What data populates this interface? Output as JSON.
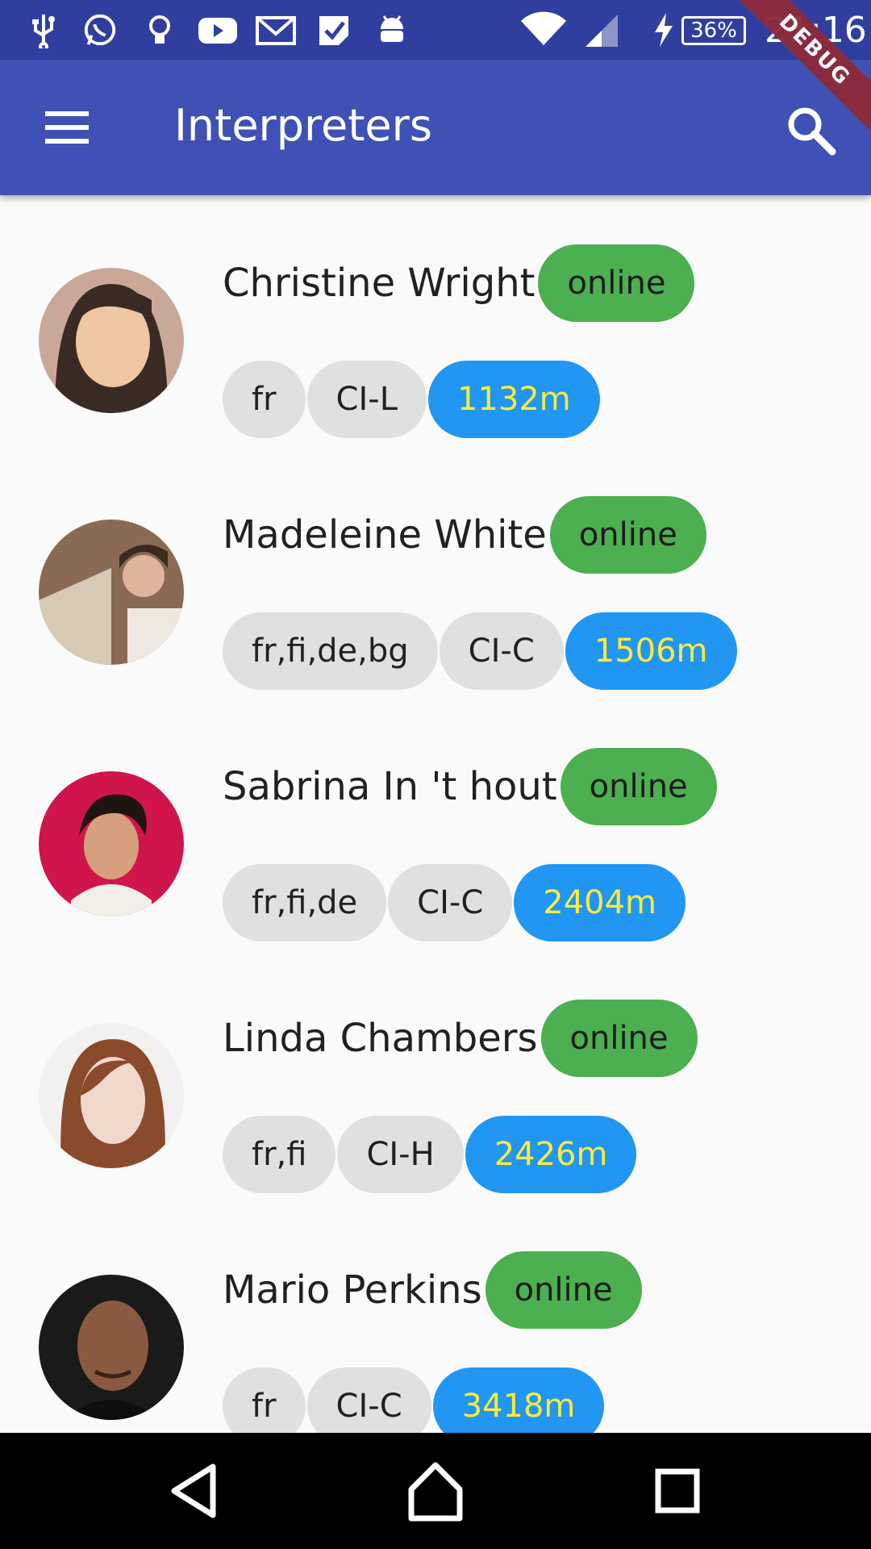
{
  "status_bar": {
    "icons": [
      "usb-icon",
      "whatsapp-icon",
      "lightbulb-icon",
      "youtube-icon",
      "gmail-icon",
      "check-icon",
      "android-icon"
    ],
    "battery": "36%",
    "time": "21:16",
    "debug_label": "DEBUG"
  },
  "app_bar": {
    "title": "Interpreters",
    "menu_icon": "menu-icon",
    "search_icon": "search-icon"
  },
  "colors": {
    "status_bar": "#303f9f",
    "app_bar": "#3f51b5",
    "online_badge": "#4caf50",
    "distance_chip": "#2196f3",
    "distance_text": "#ffeb3b",
    "chip": "#e0e0e0"
  },
  "interpreters": [
    {
      "name": "Christine Wright",
      "status": "online",
      "languages": "fr",
      "level": "CI-L",
      "distance": "1132m"
    },
    {
      "name": "Madeleine White",
      "status": "online",
      "languages": "fr,fi,de,bg",
      "level": "CI-C",
      "distance": "1506m"
    },
    {
      "name": "Sabrina In 't hout",
      "status": "online",
      "languages": "fr,fi,de",
      "level": "CI-C",
      "distance": "2404m"
    },
    {
      "name": "Linda Chambers",
      "status": "online",
      "languages": "fr,fi",
      "level": "CI-H",
      "distance": "2426m"
    },
    {
      "name": "Mario Perkins",
      "status": "online",
      "languages": "fr",
      "level": "CI-C",
      "distance": "3418m"
    }
  ],
  "nav_bar": [
    "back-icon",
    "home-icon",
    "recents-icon"
  ]
}
